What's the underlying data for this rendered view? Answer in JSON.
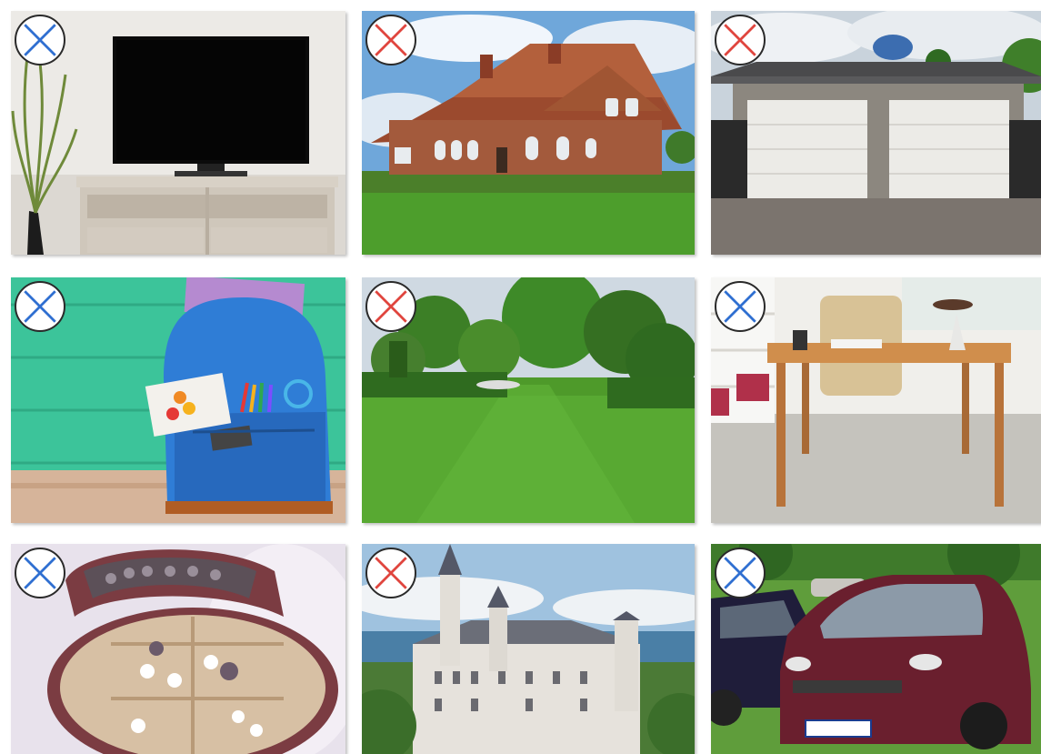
{
  "colors": {
    "badge_blue": "#2f6fd1",
    "badge_red": "#e0453e",
    "badge_border": "#2a2a2a"
  },
  "tiles": [
    {
      "name": "tv-on-stand",
      "badge": "blue"
    },
    {
      "name": "brick-house",
      "badge": "red"
    },
    {
      "name": "double-garage",
      "badge": "red"
    },
    {
      "name": "blue-backpack",
      "badge": "blue"
    },
    {
      "name": "garden-lawn",
      "badge": "red"
    },
    {
      "name": "wooden-desk",
      "badge": "blue"
    },
    {
      "name": "jewelry-box",
      "badge": "blue"
    },
    {
      "name": "castle",
      "badge": "red"
    },
    {
      "name": "parked-cars",
      "badge": "blue"
    }
  ]
}
